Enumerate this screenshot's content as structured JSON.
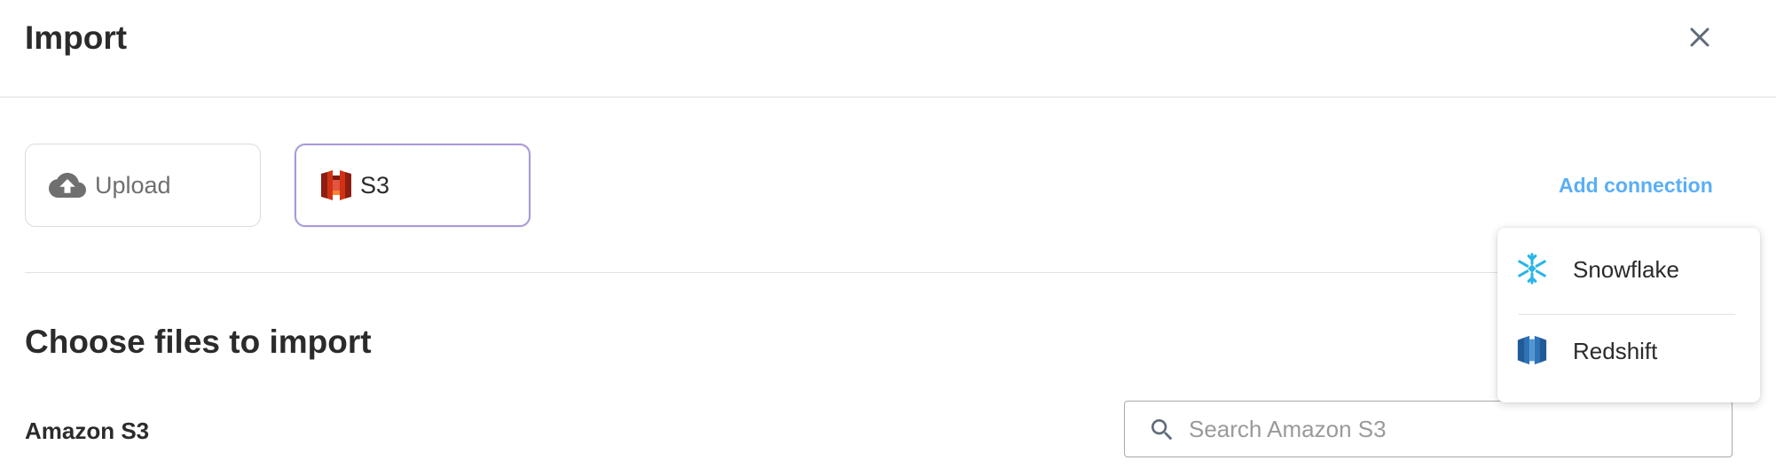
{
  "header": {
    "title": "Import",
    "close_icon": "close-icon"
  },
  "sources": {
    "upload": {
      "label": "Upload",
      "icon": "cloud-upload-icon"
    },
    "s3": {
      "label": "S3",
      "icon": "amazon-s3-icon"
    }
  },
  "add_connection": {
    "label": "Add connection"
  },
  "connection_menu": {
    "items": [
      {
        "label": "Snowflake",
        "icon": "snowflake-icon"
      },
      {
        "label": "Redshift",
        "icon": "redshift-icon"
      }
    ]
  },
  "main": {
    "section_title": "Choose files to import",
    "source_label": "Amazon S3",
    "search": {
      "placeholder": "Search Amazon S3",
      "value": ""
    }
  },
  "colors": {
    "accent": "#5aaef7",
    "selected_border": "#a99ad8",
    "s3_red": "#d13212",
    "snowflake_blue": "#29b5e8",
    "redshift_blue": "#205b98"
  }
}
